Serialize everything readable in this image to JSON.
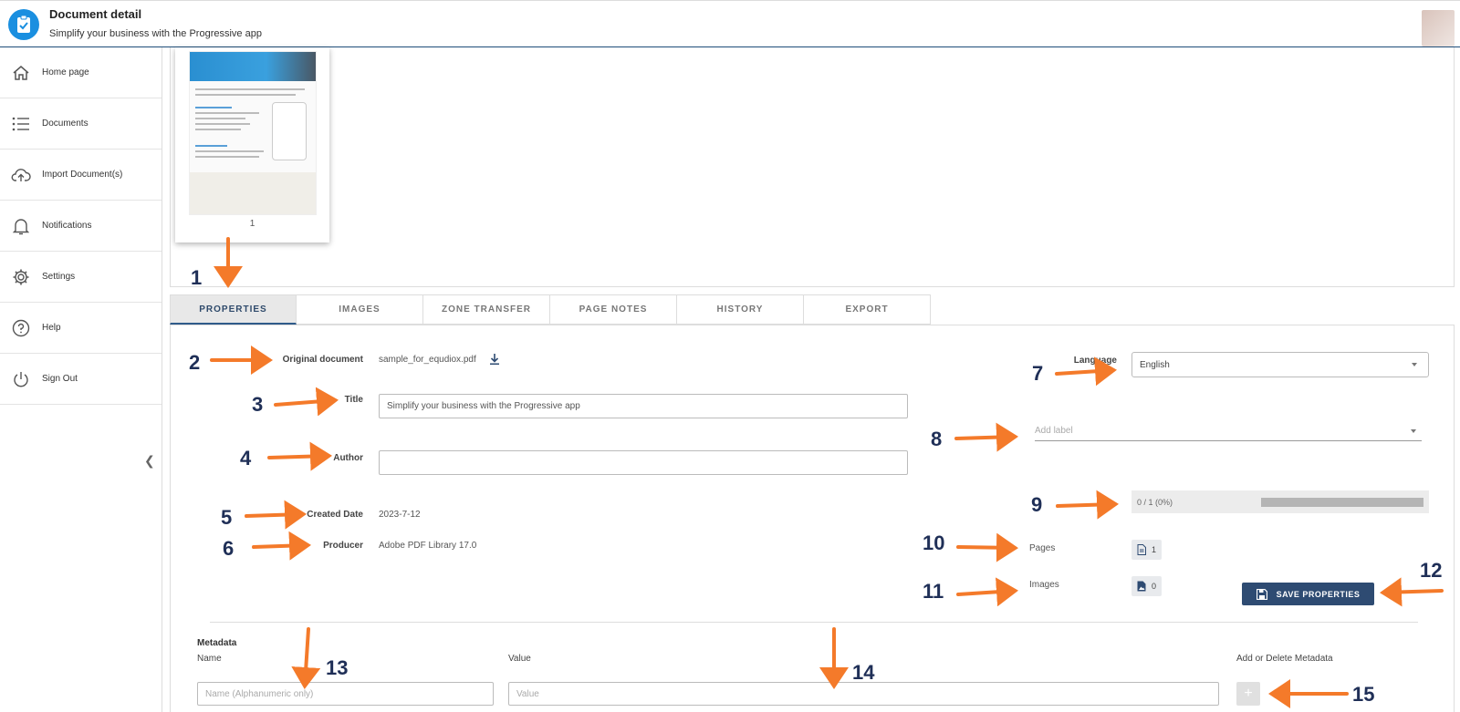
{
  "header": {
    "title": "Document detail",
    "subtitle": "Simplify your business with the Progressive app"
  },
  "sidebar": {
    "items": [
      {
        "label": "Home page",
        "icon": "home-icon"
      },
      {
        "label": "Documents",
        "icon": "list-icon"
      },
      {
        "label": "Import Document(s)",
        "icon": "cloud-upload-icon"
      },
      {
        "label": "Notifications",
        "icon": "bell-icon"
      },
      {
        "label": "Settings",
        "icon": "gear-icon"
      },
      {
        "label": "Help",
        "icon": "help-icon"
      },
      {
        "label": "Sign Out",
        "icon": "power-icon"
      }
    ]
  },
  "thumbnail": {
    "page_number": "1"
  },
  "tabs": [
    "PROPERTIES",
    "IMAGES",
    "ZONE TRANSFER",
    "PAGE NOTES",
    "HISTORY",
    "EXPORT"
  ],
  "active_tab": "PROPERTIES",
  "properties": {
    "original_document_label": "Original document",
    "original_document_value": "sample_for_equdiox.pdf",
    "title_label": "Title",
    "title_value": "Simplify your business with the Progressive app",
    "author_label": "Author",
    "author_value": "",
    "created_label": "Created Date",
    "created_value": "2023-7-12",
    "producer_label": "Producer",
    "producer_value": "Adobe PDF Library 17.0",
    "language_label": "Language",
    "language_value": "English",
    "label_placeholder": "Add label",
    "progress_text": "0 / 1 (0%)",
    "progress_fraction": 0,
    "pages_label": "Pages",
    "pages_count": "1",
    "images_label": "Images",
    "images_count": "0",
    "save_label": "SAVE PROPERTIES"
  },
  "metadata": {
    "heading": "Metadata",
    "name_label": "Name",
    "value_label": "Value",
    "add_delete_label": "Add or Delete Metadata",
    "name_placeholder": "Name (Alphanumeric only)",
    "value_placeholder": "Value",
    "add_symbol": "+"
  },
  "annotations": [
    "1",
    "2",
    "3",
    "4",
    "5",
    "6",
    "7",
    "8",
    "9",
    "10",
    "11",
    "12",
    "13",
    "14",
    "15"
  ],
  "colors": {
    "annotation_arrow": "#f47a2a",
    "annotation_number": "#1f2f57",
    "primary_button": "#2e4b72",
    "header_accent": "#1a8fe0"
  }
}
